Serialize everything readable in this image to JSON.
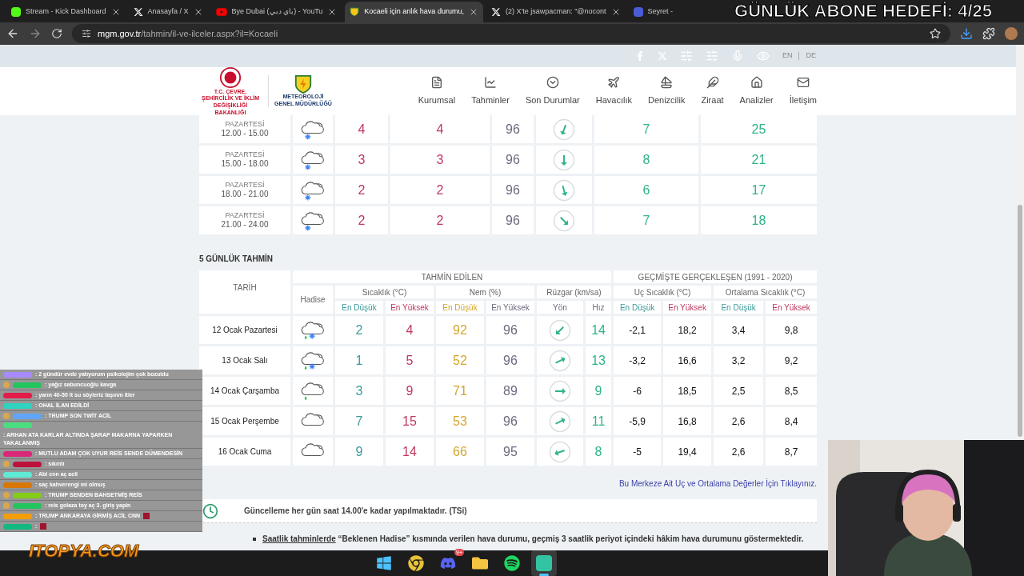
{
  "overlay_title": "GÜNLÜK ABONE HEDEFİ: 4/25",
  "browser": {
    "tabs": [
      {
        "title": "Stream - Kick Dashboard",
        "kind": "kick",
        "selected": false
      },
      {
        "title": "Anasayfa / X",
        "kind": "x",
        "selected": false
      },
      {
        "title": "Bye Dubai (باي دبي) - YouTu",
        "kind": "youtube",
        "selected": false
      },
      {
        "title": "Kocaeli için anlık hava durumu,",
        "kind": "site",
        "selected": true
      },
      {
        "title": "(2) X'te jsawpacman: \"@nocont",
        "kind": "x",
        "selected": false
      },
      {
        "title": "Seyret -",
        "kind": "generic",
        "selected": false
      }
    ],
    "url_host": "mgm.gov.tr",
    "url_path": "/tahmin/il-ve-ilceler.aspx?il=Kocaeli"
  },
  "site": {
    "languages": [
      "EN",
      "DE"
    ],
    "ministry": "T.C. ÇEVRE, ŞEHİRCİLİK VE İKLİM DEĞİŞİKLİĞİ BAKANLIĞI",
    "agency": [
      "METEOROLOJİ",
      "GENEL MÜDÜRLÜĞÜ"
    ],
    "nav": [
      {
        "label": "Kurumsal",
        "kind": "document"
      },
      {
        "label": "Tahminler",
        "kind": "chart"
      },
      {
        "label": "Son Durumlar",
        "kind": "circle-chevron"
      },
      {
        "label": "Havacılık",
        "kind": "plane"
      },
      {
        "label": "Denizcilik",
        "kind": "boat"
      },
      {
        "label": "Ziraat",
        "kind": "feather"
      },
      {
        "label": "Analizler",
        "kind": "house"
      },
      {
        "label": "İletişim",
        "kind": "mail"
      }
    ]
  },
  "hourly_rows": [
    {
      "day": "PAZARTESİ",
      "time": "12.00 - 15.00",
      "weather": {
        "kind": "snow"
      },
      "column_3": "4",
      "column_4": "4",
      "column_5": "96",
      "wind": {
        "kind": "ssw"
      },
      "column_7": "7",
      "column_8": "25"
    },
    {
      "day": "PAZARTESİ",
      "time": "15.00 - 18.00",
      "weather": {
        "kind": "snow"
      },
      "column_3": "3",
      "column_4": "3",
      "column_5": "96",
      "wind": {
        "kind": "s"
      },
      "column_7": "8",
      "column_8": "21"
    },
    {
      "day": "PAZARTESİ",
      "time": "18.00 - 21.00",
      "weather": {
        "kind": "snow"
      },
      "column_3": "2",
      "column_4": "2",
      "column_5": "96",
      "wind": {
        "kind": "sse"
      },
      "column_7": "6",
      "column_8": "17"
    },
    {
      "day": "PAZARTESİ",
      "time": "21.00 - 24.00",
      "weather": {
        "kind": "snow"
      },
      "column_3": "2",
      "column_4": "2",
      "column_5": "96",
      "wind": {
        "kind": "se"
      },
      "column_7": "7",
      "column_8": "18"
    }
  ],
  "five_day": {
    "title": "5 GÜNLÜK TAHMİN",
    "date_header": "TARİH",
    "weather_header": "Hadise",
    "group_forecast": "TAHMİN EDİLEN",
    "group_past": "GEÇMİŞTE GERÇEKLEŞEN (1991 - 2020)",
    "groups": [
      {
        "label": "Sıcaklık (°C)",
        "sub": [
          {
            "label": "En Düşük",
            "kind": "low"
          },
          {
            "label": "En Yüksek",
            "kind": "high"
          }
        ]
      },
      {
        "label": "Nem (%)",
        "sub": [
          {
            "label": "En Düşük",
            "kind": "gold"
          },
          {
            "label": "En Yüksek",
            "kind": "neutral"
          }
        ]
      },
      {
        "label": "Rüzgar (km/sa)",
        "sub": [
          {
            "label": "Yön",
            "kind": "neutral"
          },
          {
            "label": "Hız",
            "kind": "neutral"
          }
        ]
      },
      {
        "label": "Uç Sıcaklık (°C)",
        "sub": [
          {
            "label": "En Düşük",
            "kind": "low"
          },
          {
            "label": "En Yüksek",
            "kind": "high"
          }
        ]
      },
      {
        "label": "Ortalama Sıcaklık (°C)",
        "sub": [
          {
            "label": "En Düşük",
            "kind": "low"
          },
          {
            "label": "En Yüksek",
            "kind": "high"
          }
        ]
      }
    ],
    "rows": [
      {
        "date": "12 Ocak Pazartesi",
        "weather": {
          "kind": "sleet"
        },
        "temp_low": "2",
        "temp_high": "4",
        "humidity_low": "92",
        "humidity_high": "96",
        "wind": {
          "kind": "sw"
        },
        "wind_speed": "14",
        "extreme_low": "-2,1",
        "extreme_high": "18,2",
        "mean_low": "3,4",
        "mean_high": "9,8"
      },
      {
        "date": "13 Ocak Salı",
        "weather": {
          "kind": "sleet"
        },
        "temp_low": "1",
        "temp_high": "5",
        "humidity_low": "52",
        "humidity_high": "96",
        "wind": {
          "kind": "ene"
        },
        "wind_speed": "13",
        "extreme_low": "-3,2",
        "extreme_high": "16,6",
        "mean_low": "3,2",
        "mean_high": "9,2"
      },
      {
        "date": "14 Ocak Çarşamba",
        "weather": {
          "kind": "rain"
        },
        "temp_low": "3",
        "temp_high": "9",
        "humidity_low": "71",
        "humidity_high": "89",
        "wind": {
          "kind": "e"
        },
        "wind_speed": "9",
        "extreme_low": "-6",
        "extreme_high": "18,5",
        "mean_low": "2,5",
        "mean_high": "8,5"
      },
      {
        "date": "15 Ocak Perşembe",
        "weather": {
          "kind": "cloudy"
        },
        "temp_low": "7",
        "temp_high": "15",
        "humidity_low": "53",
        "humidity_high": "96",
        "wind": {
          "kind": "ene"
        },
        "wind_speed": "11",
        "extreme_low": "-5,9",
        "extreme_high": "16,8",
        "mean_low": "2,6",
        "mean_high": "8,4"
      },
      {
        "date": "16 Ocak Cuma",
        "weather": {
          "kind": "cloudy"
        },
        "temp_low": "9",
        "temp_high": "14",
        "humidity_low": "66",
        "humidity_high": "95",
        "wind": {
          "kind": "wsw"
        },
        "wind_speed": "8",
        "extreme_low": "-5",
        "extreme_high": "19,4",
        "mean_low": "2,6",
        "mean_high": "8,7"
      }
    ],
    "link": "Bu Merkeze Ait Uç ve Ortalama Değerler İçin Tıklayınız."
  },
  "update_note": "Güncelleme her gün saat 14.00'e kadar yapılmaktadır. (TSi)",
  "notes": [
    {
      "link": "Saatlik tahminlerde",
      "text": "“Beklenen Hadise” kısmında verilen hava durumu, geçmiş 3 saatlik periyot içindeki hâkim hava durumunu göstermektedir."
    }
  ],
  "chat": [
    {
      "color": "#a78bfa",
      "badge": false,
      "message": ": 2 gündür evde yatıyorum psikolojim çok bozuldu",
      "emote": false
    },
    {
      "color": "#22c55e",
      "badge": true,
      "message": ": yağız sabuncuoğlu kavga",
      "emote": false
    },
    {
      "color": "#e11d48",
      "badge": false,
      "message": ": yarın 40-50 lt su söyleriz taşınm itler",
      "emote": false
    },
    {
      "color": "#2dd4bf",
      "badge": false,
      "message": ": OHAL İLAN EDİLDİ",
      "emote": false
    },
    {
      "color": "#60a5fa",
      "badge": true,
      "message": ": TRUMP SON TWİT ACİL",
      "emote": false
    },
    {
      "color": "#4ade80",
      "badge": false,
      "message": ": ARHAN ATA KARLAR ALTINDA ŞARAP MAKARNA YAPARKEN YAKALANMIŞ",
      "emote": false
    },
    {
      "color": "#db2777",
      "badge": false,
      "message": ": MUTLU ADAM ÇOK UYUR REİS SENDE DÜMENDESİN",
      "emote": false
    },
    {
      "color": "#be123c",
      "badge": true,
      "message": ": sıkıntı",
      "emote": false
    },
    {
      "color": "#5eead4",
      "badge": false,
      "message": ": Abi cnn aç acil",
      "emote": false
    },
    {
      "color": "#d97706",
      "badge": false,
      "message": ": saç kahverengi mi olmuş",
      "emote": false
    },
    {
      "color": "#84cc16",
      "badge": true,
      "message": ": TRUMP SENDEN BAHSETMİŞ REİS",
      "emote": false
    },
    {
      "color": "#22c55e",
      "badge": true,
      "message": ": reis golaza toy aç 3. giriş yapin",
      "emote": false
    },
    {
      "color": "#f59e0b",
      "badge": false,
      "message": ": TRUMP ANKARAYA GİRMİŞ ACİL CNN",
      "emote": true
    },
    {
      "color": "#10b981",
      "badge": false,
      "message": ":",
      "emote": true
    }
  ],
  "stream_logo": "ITOPYA.COM",
  "taskbar": [
    {
      "kind": "windows",
      "active": false
    },
    {
      "kind": "chrome",
      "active": false
    },
    {
      "kind": "discord",
      "active": false,
      "badge": "9+"
    },
    {
      "kind": "folder",
      "active": false
    },
    {
      "kind": "spotify",
      "active": false
    },
    {
      "kind": "app",
      "active": true
    }
  ]
}
